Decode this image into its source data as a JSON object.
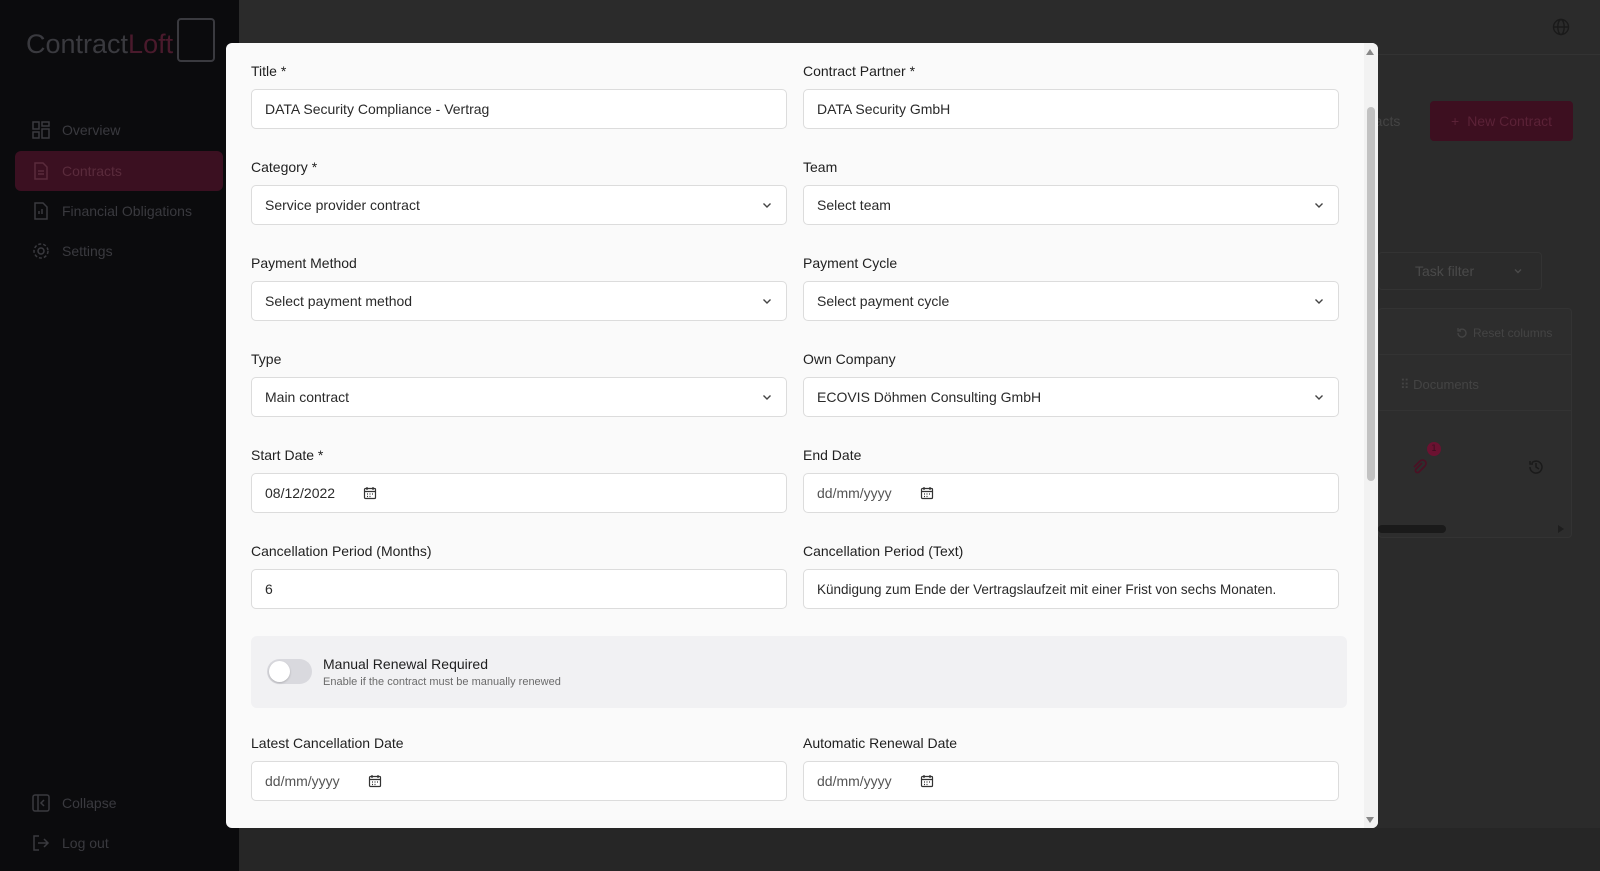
{
  "sidebar": {
    "logo_main": "Contract",
    "logo_accent": "Loft",
    "items": [
      {
        "label": "Overview",
        "icon": "dashboard-icon"
      },
      {
        "label": "Contracts",
        "icon": "document-icon"
      },
      {
        "label": "Financial Obligations",
        "icon": "finance-icon"
      },
      {
        "label": "Settings",
        "icon": "gear-icon"
      }
    ],
    "collapse_label": "Collapse",
    "logout_label": "Log out"
  },
  "background": {
    "new_contract_label": "New Contract",
    "contracts_fragment": "racts",
    "task_filter_label": "Task filter",
    "reset_columns_label": "Reset columns",
    "documents_column": "Documents",
    "attachment_count": "1"
  },
  "form": {
    "title": {
      "label": "Title *",
      "value": "DATA Security Compliance - Vertrag"
    },
    "contract_partner": {
      "label": "Contract Partner *",
      "value": "DATA Security GmbH"
    },
    "category": {
      "label": "Category *",
      "value": "Service provider contract"
    },
    "team": {
      "label": "Team",
      "value": "Select team"
    },
    "payment_method": {
      "label": "Payment Method",
      "value": "Select payment method"
    },
    "payment_cycle": {
      "label": "Payment Cycle",
      "value": "Select payment cycle"
    },
    "type": {
      "label": "Type",
      "value": "Main contract"
    },
    "own_company": {
      "label": "Own Company",
      "value": "ECOVIS Döhmen Consulting GmbH"
    },
    "start_date": {
      "label": "Start Date *",
      "value": "08/12/2022"
    },
    "end_date": {
      "label": "End Date",
      "value": "dd/mm/yyyy"
    },
    "cancellation_months": {
      "label": "Cancellation Period (Months)",
      "value": "6"
    },
    "cancellation_text": {
      "label": "Cancellation Period (Text)",
      "value": "Kündigung zum Ende der Vertragslaufzeit mit einer Frist von sechs Monaten."
    },
    "manual_renewal": {
      "title": "Manual Renewal Required",
      "description": "Enable if the contract must be manually renewed",
      "enabled": false
    },
    "latest_cancellation": {
      "label": "Latest Cancellation Date",
      "value": "dd/mm/yyyy"
    },
    "automatic_renewal": {
      "label": "Automatic Renewal Date",
      "value": "dd/mm/yyyy"
    }
  },
  "colors": {
    "accent": "#6b1231",
    "modal_bg": "#fafafa"
  }
}
